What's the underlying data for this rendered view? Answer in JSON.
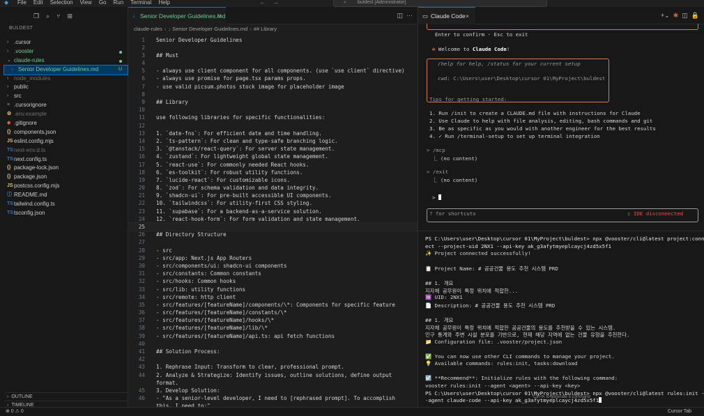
{
  "menu": [
    "File",
    "Edit",
    "Selection",
    "View",
    "Go",
    "Run",
    "Terminal",
    "Help"
  ],
  "search": {
    "text": "buldest [Administrator]"
  },
  "sidebar": {
    "title": "BULDEST",
    "items": [
      {
        "label": ".cursor",
        "type": "folder",
        "status": ""
      },
      {
        "label": ".vooster",
        "type": "folder",
        "status": "dot"
      },
      {
        "label": "claude-rules",
        "type": "folder",
        "status": "dot"
      },
      {
        "label": "Senior Developer Guidelines.md",
        "type": "file",
        "status": "U"
      },
      {
        "label": "node_modules",
        "type": "folder",
        "status": ""
      },
      {
        "label": "public",
        "type": "folder",
        "status": ""
      },
      {
        "label": "src",
        "type": "folder",
        "status": ""
      },
      {
        "label": ".cursorignore",
        "type": "file",
        "status": ""
      },
      {
        "label": ".env.example",
        "type": "file",
        "status": ""
      },
      {
        "label": ".gitignore",
        "type": "file",
        "status": ""
      },
      {
        "label": "components.json",
        "type": "file",
        "status": ""
      },
      {
        "label": "eslint.config.mjs",
        "type": "file",
        "status": ""
      },
      {
        "label": "next-env.d.ts",
        "type": "file",
        "status": ""
      },
      {
        "label": "next.config.ts",
        "type": "file",
        "status": ""
      },
      {
        "label": "package-lock.json",
        "type": "file",
        "status": ""
      },
      {
        "label": "package.json",
        "type": "file",
        "status": ""
      },
      {
        "label": "postcss.config.mjs",
        "type": "file",
        "status": ""
      },
      {
        "label": "README.md",
        "type": "file",
        "status": ""
      },
      {
        "label": "tailwind.config.ts",
        "type": "file",
        "status": ""
      },
      {
        "label": "tsconfig.json",
        "type": "file",
        "status": ""
      }
    ],
    "outline": "OUTLINE",
    "timeline": "TIMELINE"
  },
  "editor": {
    "tab_label": "Senior Developer Guidelines.md",
    "tab_status": "U",
    "breadcrumb": [
      "claude-rules",
      "Senior Developer Guidelines.md",
      "## Library"
    ],
    "lines": [
      {
        "n": "1",
        "t": "Senior Developer Guidelines"
      },
      {
        "n": "2",
        "t": ""
      },
      {
        "n": "3",
        "t": "## Must"
      },
      {
        "n": "4",
        "t": ""
      },
      {
        "n": "5",
        "t": "- always use client component for all components. (use `use client` directive)"
      },
      {
        "n": "6",
        "t": "- always use promise for page.tsx params props."
      },
      {
        "n": "7",
        "t": "- use valid picsum.photos stock image for placeholder image"
      },
      {
        "n": "8",
        "t": ""
      },
      {
        "n": "9",
        "t": "## Library"
      },
      {
        "n": "10",
        "t": ""
      },
      {
        "n": "11",
        "t": "use following libraries for specific functionalities:"
      },
      {
        "n": "12",
        "t": ""
      },
      {
        "n": "13",
        "t": "1. `date-fns`: For efficient date and time handling."
      },
      {
        "n": "14",
        "t": "2. `ts-pattern`: For clean and type-safe branching logic."
      },
      {
        "n": "15",
        "t": "3. `@tanstack/react-query`: For server state management."
      },
      {
        "n": "16",
        "t": "4. `zustand`: For lightweight global state management."
      },
      {
        "n": "17",
        "t": "5. `react-use`: For commonly needed React hooks."
      },
      {
        "n": "18",
        "t": "6. `es-toolkit`: For robust utility functions."
      },
      {
        "n": "19",
        "t": "7. `lucide-react`: For customizable icons."
      },
      {
        "n": "20",
        "t": "8. `zod`: For schema validation and data integrity."
      },
      {
        "n": "21",
        "t": "9. `shadcn-ui`: For pre-built accessible UI components."
      },
      {
        "n": "22",
        "t": "10. `tailwindcss`: For utility-first CSS styling."
      },
      {
        "n": "23",
        "t": "11. `supabase`: For a backend-as-a-service solution."
      },
      {
        "n": "24",
        "t": "12. `react-hook-form`: For form validation and state management."
      },
      {
        "n": "25",
        "t": ""
      },
      {
        "n": "26",
        "t": "## Directory Structure"
      },
      {
        "n": "27",
        "t": ""
      },
      {
        "n": "28",
        "t": "- src"
      },
      {
        "n": "29",
        "t": "- src/app: Next.js App Routers"
      },
      {
        "n": "30",
        "t": "- src/components/ui: shadcn-ui components"
      },
      {
        "n": "31",
        "t": "- src/constants: Common constants"
      },
      {
        "n": "32",
        "t": "- src/hooks: Common hooks"
      },
      {
        "n": "33",
        "t": "- src/lib: utility functions"
      },
      {
        "n": "34",
        "t": "- src/remote: http client"
      },
      {
        "n": "35",
        "t": "- src/features/[featureName]/components/\\*: Components for specific feature"
      },
      {
        "n": "36",
        "t": "- src/features/[featureName]/constants/\\*"
      },
      {
        "n": "37",
        "t": "- src/features/[featureName]/hooks/\\*"
      },
      {
        "n": "38",
        "t": "- src/features/[featureName]/lib/\\*"
      },
      {
        "n": "39",
        "t": "- src/features/[featureName]/api.ts: api fetch functions"
      },
      {
        "n": "40",
        "t": ""
      },
      {
        "n": "41",
        "t": "## Solution Process:"
      },
      {
        "n": "42",
        "t": ""
      },
      {
        "n": "43",
        "t": "1. Rephrase Input: Transform to clear, professional prompt."
      },
      {
        "n": "44",
        "t": "2. Analyze & Strategize: Identify issues, outline solutions, define output"
      },
      {
        "n": "",
        "t": "format."
      },
      {
        "n": "45",
        "t": "3. Develop Solution:"
      },
      {
        "n": "46",
        "t": "   - \"As a senior-level developer, I need to [rephrased prompt]. To accomplish"
      },
      {
        "n": "",
        "t": "   this, I need to:\""
      }
    ],
    "current_line": "25"
  },
  "claude_panel": {
    "tab_label": "Claude Code",
    "confirm_hint": "Enter to confirm · Esc to exit",
    "welcome_title_pre": "Welcome to ",
    "welcome_title_bold": "Claude Code",
    "welcome_title_post": "!",
    "welcome_help": "/help for help, /status for your current setup",
    "welcome_cwd": "cwd: C:\\Users\\user\\Desktop\\cursor 01\\MyProject\\buldest",
    "tips_title": "Tips for getting started:",
    "tips": [
      "1. Run /init to create a CLAUDE.md file with instructions for Claude",
      "2. Use Claude to help with file analysis, editing, bash commands and git",
      "3. Be as specific as you would with another engineer for the best results",
      "4. ✓ Run /terminal-setup to set up terminal integration"
    ],
    "cmd1": "> /mcp",
    "out1": "⎿  (no content)",
    "cmd2": "> /exit",
    "out2": "⎿  (no content)",
    "prompt": ">",
    "shortcuts": "? for shortcuts",
    "ide_status": "IDE disconnected"
  },
  "terminal": {
    "lines": [
      {
        "t": "PS C:\\Users\\user\\Desktop\\cursor 01\\MyProject\\buldest> npx @vooster/cli@latest project:conn",
        "k": "cmd"
      },
      {
        "t": "ect --project-uid 2NX1 --api-key ak_g3afytmyeplcaycj4zd5x5f1",
        "k": "cmd2"
      },
      {
        "t": "✨ Project connected successfully!",
        "k": "plain"
      },
      {
        "t": "",
        "k": "plain"
      },
      {
        "t": "📋 Project Name: # 공공건물 용도 추천 시스템 PRD",
        "k": "plain"
      },
      {
        "t": "",
        "k": "plain"
      },
      {
        "t": "## 1. 개요",
        "k": "plain"
      },
      {
        "t": "지자체 공무원이 특정 위치에 적합한...",
        "k": "plain"
      },
      {
        "t": "🆔 UID: 2NX1",
        "k": "plain"
      },
      {
        "t": "📄 Description: # 공공건물 용도 추천 시스템 PRD",
        "k": "plain"
      },
      {
        "t": "",
        "k": "plain"
      },
      {
        "t": "## 1. 개요",
        "k": "plain"
      },
      {
        "t": "지자체 공무원이 특정 위치에 적합한 공공건물의 용도를 추천받을 수 있는 시스템.",
        "k": "plain"
      },
      {
        "t": "인구 통계와 주변 시설 분포를 기반으로, 현재 해당 지역에 없는 건물 유형을 추천한다.",
        "k": "plain"
      },
      {
        "t": "📁 Configuration file: .vooster/project.json",
        "k": "plain"
      },
      {
        "t": "",
        "k": "plain"
      },
      {
        "t": "✅ You can now use other CLI commands to manage your project.",
        "k": "plain"
      },
      {
        "t": "💡 Available commands: rules:init, tasks:download",
        "k": "plain"
      },
      {
        "t": "",
        "k": "plain"
      },
      {
        "t": "☑️ **Recommend**: Initialize rules with the following command:",
        "k": "plain"
      },
      {
        "t": "vooster rules:init --agent <agent> --api-key <key>",
        "k": "plain"
      },
      {
        "t": "PS C:\\Users\\user\\Desktop\\cursor 01\\MyProject\\buldest> npx @vooster/cli@latest rules:init -",
        "k": "cmd"
      },
      {
        "t": "-agent claude-code --api-key ak_g3afytmyeplcaycj4zd5x5f1",
        "k": "cmd2"
      }
    ],
    "hint": "Ctrl+K to generate a command"
  },
  "statusbar": {
    "left": "⊗ 0 ⚠ 0",
    "right": "Cursor Tab"
  },
  "colors": {
    "accent": "#0078d4",
    "claude": "#d97757",
    "git_untracked": "#73c991"
  }
}
